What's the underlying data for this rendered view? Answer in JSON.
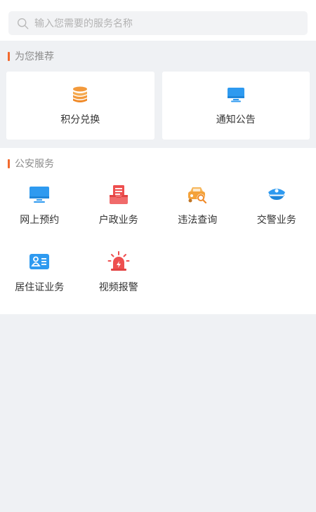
{
  "search": {
    "placeholder": "输入您需要的服务名称"
  },
  "recommend": {
    "title": "为您推荐",
    "items": [
      {
        "label": "积分兑换",
        "icon": "coin-stack-icon",
        "color": "#f39a3c"
      },
      {
        "label": "通知公告",
        "icon": "monitor-icon",
        "color": "#2e9af0"
      }
    ]
  },
  "police": {
    "title": "公安服务",
    "items": [
      {
        "label": "网上预约",
        "icon": "monitor-icon",
        "color": "#2e9af0"
      },
      {
        "label": "户政业务",
        "icon": "document-tray-icon",
        "color": "#ee4f4f"
      },
      {
        "label": "违法查询",
        "icon": "car-search-icon",
        "color": "#f4a23a"
      },
      {
        "label": "交警业务",
        "icon": "police-cap-icon",
        "color": "#2e9af0"
      },
      {
        "label": "居住证业务",
        "icon": "id-card-icon",
        "color": "#2e9af0"
      },
      {
        "label": "视频报警",
        "icon": "alarm-siren-icon",
        "color": "#ee4f4f"
      }
    ]
  },
  "colors": {
    "accent": "#f26a2e",
    "background": "#eff1f4"
  }
}
